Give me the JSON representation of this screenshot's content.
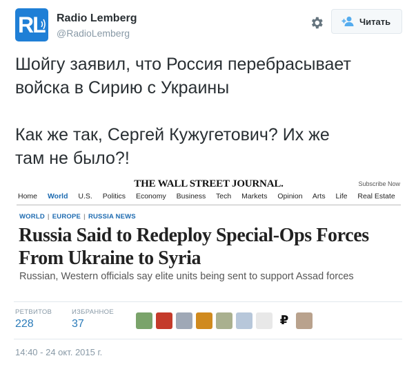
{
  "account": {
    "name": "Radio Lemberg",
    "handle": "@RadioLemberg",
    "avatar_text": "RL",
    "brand_color": "#1f7fd6"
  },
  "actions": {
    "settings_icon": "gear-icon",
    "follow_icon": "add-user-icon",
    "follow_label": "Читать"
  },
  "tweet": {
    "lines": [
      "Шойгу заявил, что Россия перебрасывает",
      "войска в Сирию с Украины",
      "",
      "Как же так, Сергей Кужугетович? Их же",
      "там не было?!"
    ]
  },
  "media": {
    "masthead": "THE WALL STREET JOURNAL.",
    "subscribe": "Subscribe Now",
    "nav": [
      "Home",
      "World",
      "U.S.",
      "Politics",
      "Economy",
      "Business",
      "Tech",
      "Markets",
      "Opinion",
      "Arts",
      "Life",
      "Real Estate"
    ],
    "nav_active": "World",
    "kicker": [
      "WORLD",
      "EUROPE",
      "RUSSIA NEWS"
    ],
    "headline_lines": [
      "Russia Said to Redeploy Special-Ops Forces",
      "From Ukraine to Syria"
    ],
    "dek": "Russian, Western officials say elite units being sent to support Assad forces",
    "accent_color": "#1c6ab0"
  },
  "stats": {
    "retweets_label": "РЕТВИТОВ",
    "retweets_value": "228",
    "likes_label": "ИЗБРАННОЕ",
    "likes_value": "37"
  },
  "likers": [
    {
      "name": "liker-avatar-1",
      "color": "#7aa36a"
    },
    {
      "name": "liker-avatar-2",
      "color": "#c43b2b"
    },
    {
      "name": "liker-avatar-3",
      "color": "#9fa8b6"
    },
    {
      "name": "liker-avatar-4",
      "color": "#d08a1e"
    },
    {
      "name": "liker-avatar-5",
      "color": "#a9b08f"
    },
    {
      "name": "liker-avatar-6",
      "color": "#b7c7da"
    },
    {
      "name": "liker-avatar-7",
      "color": "#e8e8e8"
    },
    {
      "name": "liker-avatar-8",
      "color": "#ffffff",
      "glyph": "₽"
    },
    {
      "name": "liker-avatar-9",
      "color": "#b9a28d"
    }
  ],
  "timestamp": "14:40 - 24 окт. 2015 г."
}
